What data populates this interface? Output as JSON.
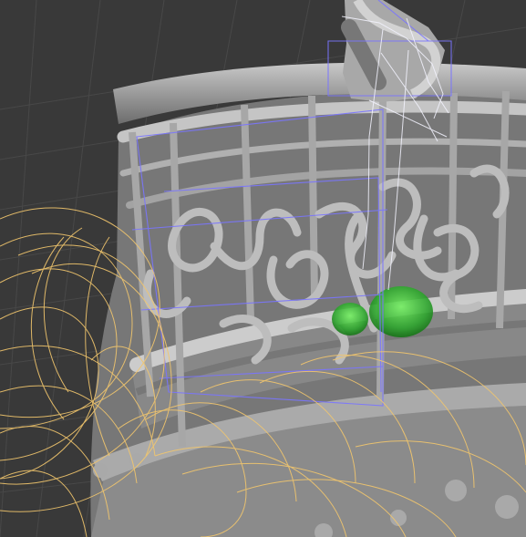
{
  "viewport": {
    "background_color": "#393939",
    "grid_color": "#4a4a4a",
    "model_color": "#9a9a9a",
    "model_shadow_color": "#6f6f6f",
    "model_highlight_color": "#c4c4c4",
    "rig_curve_color": "#f2c66d",
    "selection_wire_color": "#6f6cff",
    "bone_color": "#e8e8f0",
    "selected_handle_color": "#36c43a",
    "visible_text": []
  }
}
